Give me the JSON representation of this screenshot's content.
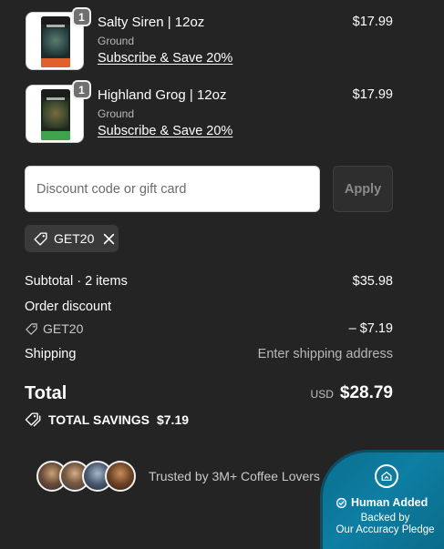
{
  "items": [
    {
      "name": "Salty Siren | 12oz",
      "variant": "Ground",
      "subscribe": "Subscribe & Save 20%",
      "price": "$17.99",
      "quantity": "1",
      "bag_art_color": "#2f4a4a",
      "bag_band_color": "#e0612b"
    },
    {
      "name": "Highland Grog | 12oz",
      "variant": "Ground",
      "subscribe": "Subscribe & Save 20%",
      "price": "$17.99",
      "quantity": "1",
      "bag_art_color": "#2d3a2b",
      "bag_band_color": "#3fa34d"
    }
  ],
  "discount": {
    "placeholder": "Discount code or gift card",
    "apply_label": "Apply",
    "applied_code": "GET20",
    "tag_icon": "tag-icon",
    "remove_icon": "close-icon"
  },
  "summary": {
    "subtotal_label": "Subtotal · 2 items",
    "subtotal_value": "$35.98",
    "order_discount_label": "Order discount",
    "discount_code": "GET20",
    "discount_value": "– $7.19",
    "shipping_label": "Shipping",
    "shipping_value": "Enter shipping address",
    "total_label": "Total",
    "currency": "USD",
    "total_value": "$28.79",
    "savings_label": "TOTAL SAVINGS",
    "savings_value": "$7.19"
  },
  "trust": {
    "text": "Trusted by 3M+ Coffee Lovers"
  },
  "badge": {
    "title": "Human Added",
    "line1": "Backed by",
    "line2": "Our Accuracy Pledge",
    "color": "#0e7ea3"
  },
  "colors": {
    "background": "#242424",
    "text": "#ffffff",
    "muted": "#b8b8b8"
  }
}
